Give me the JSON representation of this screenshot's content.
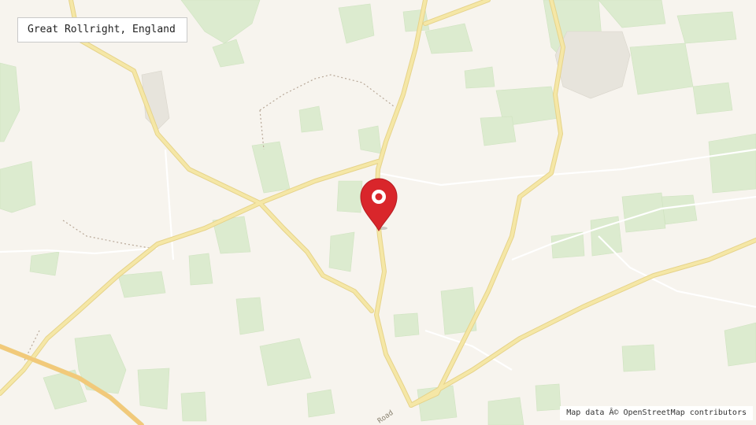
{
  "map": {
    "location_label": "Great Rollright, England",
    "attribution": "Map data Â© OpenStreetMap contributors",
    "road_label": "Road",
    "marker_icon": "map-pin-icon",
    "colors": {
      "background": "#f7f4ee",
      "fields": "#dcebcf",
      "roads": "#f5e7a6",
      "road_casing": "#e6d38a",
      "minor_roads": "#ffffff",
      "paths": "#b8a898",
      "marker": "#d9262b"
    }
  }
}
